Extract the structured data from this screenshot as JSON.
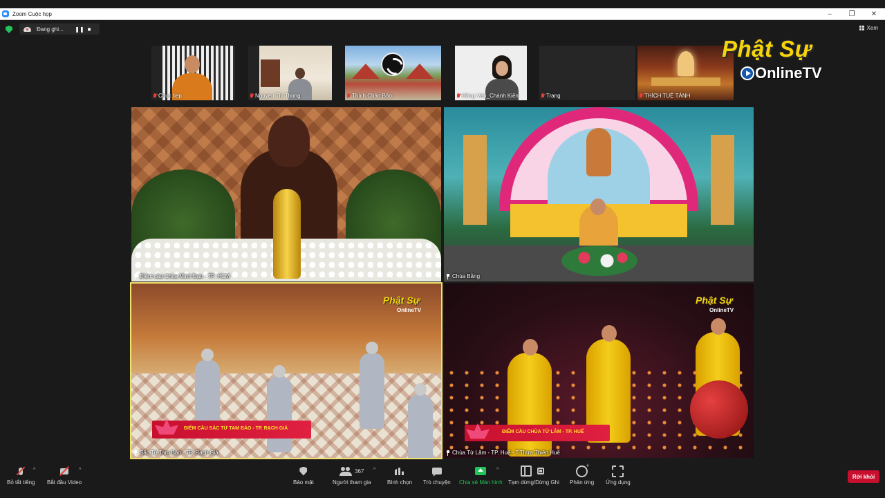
{
  "window": {
    "title": "Zoom Cuộc họp",
    "minimize": "–",
    "maximize": "❐",
    "close": "✕"
  },
  "topbar": {
    "recording_text": "Đang ghi...",
    "pause_icon": "pause-icon",
    "stop_icon": "stop-icon",
    "view_label": "Xem"
  },
  "logo": {
    "top": "Phật Sự",
    "bottom": "OnlineTV"
  },
  "thumbnails": [
    {
      "name": "Chuc tiep",
      "muted": true
    },
    {
      "name": "Nguyen Thi Thong",
      "muted": true
    },
    {
      "name": "Thích Chân Bảo",
      "muted": true
    },
    {
      "name": "Hồng Vân_Chánh Kiến",
      "muted": true
    },
    {
      "name": "Trang",
      "muted": true
    },
    {
      "name": "THÍCH TUỆ TÁNH",
      "muted": true
    }
  ],
  "tiles": [
    {
      "name": "Điểm cầu Chùa Minh Đạo - TP. HCM"
    },
    {
      "name": "Chùa Bằng"
    },
    {
      "name": "Sắc Tứ Tam Bảo - TP. Rạch Giá",
      "banner": "ĐIỂM CẦU SẮC TỨ TAM BẢO - TP. RẠCH GIÁ",
      "watermark_top": "Phật Sự",
      "watermark_bottom": "OnlineTV"
    },
    {
      "name": "Chùa Từ Lâm - TP. Huế - T.Thừa Thiên Huế",
      "banner": "ĐIỂM CẦU CHÙA TỪ LÂM - TP. HUẾ",
      "watermark_top": "Phật Sự",
      "watermark_bottom": "OnlineTV"
    }
  ],
  "toolbar": {
    "mute_label": "Bỏ tắt tiếng",
    "video_label": "Bắt đầu Video",
    "security_label": "Bảo mật",
    "participants_label": "Người tham gia",
    "participants_count": "367",
    "polls_label": "Bình chọn",
    "chat_label": "Trò chuyện",
    "share_label": "Chia sẻ Màn hình",
    "pause_label": "Tạm dừng/Dừng Ghi",
    "reactions_label": "Phản ứng",
    "apps_label": "Ứng dụng",
    "leave_label": "Rời khỏi",
    "caret": "^"
  },
  "colors": {
    "background": "#1a1a1a",
    "accent_green": "#22c25a",
    "leave_red": "#c8102e",
    "active_border": "#f2e36a",
    "logo_yellow": "#f5d40b"
  }
}
